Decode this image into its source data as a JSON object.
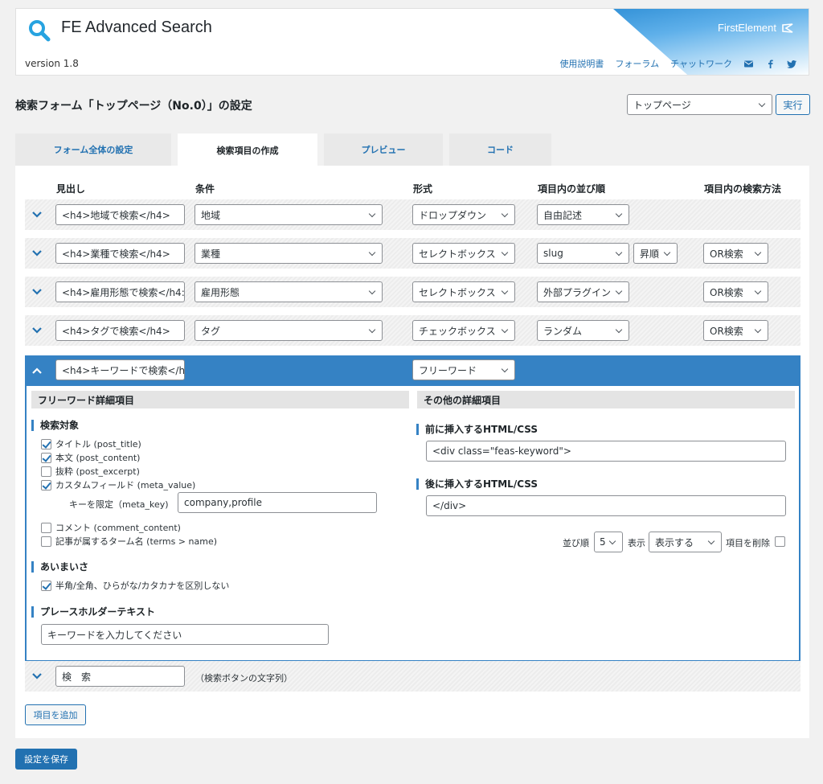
{
  "header": {
    "title": "FE Advanced Search",
    "version": "version 1.8",
    "brand": "FirstElement",
    "links": [
      "使用説明書",
      "フォーラム",
      "チャットワーク"
    ]
  },
  "page": {
    "title": "検索フォーム「トップページ（No.0）」の設定",
    "form_select": "トップページ",
    "run_label": "実行"
  },
  "tabs": [
    "フォーム全体の設定",
    "検索項目の作成",
    "プレビュー",
    "コード"
  ],
  "columns": [
    "見出し",
    "条件",
    "形式",
    "項目内の並び順",
    "項目内の検索方法"
  ],
  "rows": [
    {
      "heading": "<h4>地域で検索</h4>",
      "condition": "地域",
      "format": "ドロップダウン",
      "order": "自由記述",
      "sort_dir": "",
      "method": ""
    },
    {
      "heading": "<h4>業種で検索</h4>",
      "condition": "業種",
      "format": "セレクトボックス",
      "order": "slug",
      "sort_dir": "昇順",
      "method": "OR検索"
    },
    {
      "heading": "<h4>雇用形態で検索</h4:",
      "condition": "雇用形態",
      "format": "セレクトボックス",
      "order": "外部プラグイン",
      "sort_dir": "",
      "method": "OR検索"
    },
    {
      "heading": "<h4>タグで検索</h4>",
      "condition": "タグ",
      "format": "チェックボックス",
      "order": "ランダム",
      "sort_dir": "",
      "method": "OR検索"
    }
  ],
  "expanded": {
    "heading": "<h4>キーワードで検索</h",
    "format": "フリーワード",
    "left_title": "フリーワード詳細項目",
    "right_title": "その他の詳細項目",
    "target_title": "検索対象",
    "targets": [
      {
        "label": "タイトル (post_title)",
        "checked": true
      },
      {
        "label": "本文 (post_content)",
        "checked": true
      },
      {
        "label": "抜粋 (post_excerpt)",
        "checked": false
      },
      {
        "label": "カスタムフィールド (meta_value)",
        "checked": true
      }
    ],
    "meta_key_label": "キーを限定（meta_key)",
    "meta_key_value": "company,profile",
    "targets2": [
      {
        "label": "コメント (comment_content)",
        "checked": false
      },
      {
        "label": "記事が属するターム名 (terms > name)",
        "checked": false
      }
    ],
    "fuzzy_title": "あいまいさ",
    "fuzzy_option": {
      "label": "半角/全角、ひらがな/カタカナを区別しない",
      "checked": true
    },
    "placeholder_title": "プレースホルダーテキスト",
    "placeholder_value": "キーワードを入力してください",
    "before_title": "前に挿入するHTML/CSS",
    "before_value": "<div class=\"feas-keyword\">",
    "after_title": "後に挿入するHTML/CSS",
    "after_value": "</div>",
    "order_label": "並び順",
    "order_value": "5",
    "display_label": "表示",
    "display_value": "表示する",
    "delete_label": "項目を削除"
  },
  "search_button": {
    "value": "検　索",
    "note": "（検索ボタンの文字列）"
  },
  "add_item_label": "項目を追加",
  "save_label": "設定を保存",
  "colors": {
    "accent": "#3582c4",
    "link": "#2271b1",
    "bg": "#f1f1f1"
  }
}
